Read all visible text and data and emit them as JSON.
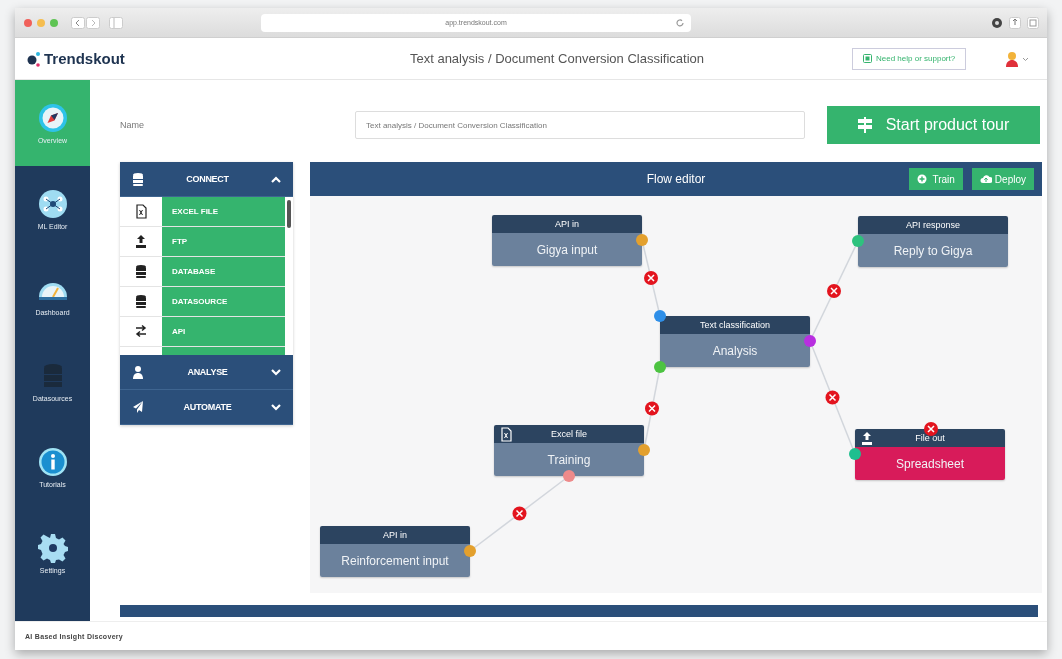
{
  "browser": {
    "url": "app.trendskout.com"
  },
  "header": {
    "logo": "Trendskout",
    "title": "Text analysis / Document Conversion Classification",
    "help_button": "Need help or support?"
  },
  "nav": [
    {
      "label": "Overview",
      "kind": "compass",
      "selected": true
    },
    {
      "label": "ML Editor",
      "kind": "network",
      "selected": false
    },
    {
      "label": "Dashboard",
      "kind": "gauge",
      "selected": false
    },
    {
      "label": "Datasources",
      "kind": "database",
      "selected": false
    },
    {
      "label": "Tutorials",
      "kind": "info",
      "selected": false
    },
    {
      "label": "Settings",
      "kind": "gear",
      "selected": false
    }
  ],
  "name_field": {
    "label": "Name",
    "value": "Text analysis / Document Conversion Classification"
  },
  "tour_button": "Start product tour",
  "toolbox": [
    {
      "label": "CONNECT",
      "kind": "database",
      "expanded": true,
      "items": [
        {
          "label": "EXCEL FILE",
          "kind": "file"
        },
        {
          "label": "FTP",
          "kind": "upload"
        },
        {
          "label": "DATABASE",
          "kind": "database"
        },
        {
          "label": "DATASOURCE",
          "kind": "database"
        },
        {
          "label": "API",
          "kind": "exchange"
        }
      ]
    },
    {
      "label": "ANALYSE",
      "kind": "person",
      "expanded": false
    },
    {
      "label": "AUTOMATE",
      "kind": "send",
      "expanded": false
    }
  ],
  "flow_editor": {
    "title": "Flow editor",
    "buttons": [
      {
        "label": "Train",
        "kind": "plus"
      },
      {
        "label": "Deploy",
        "kind": "cloud"
      }
    ],
    "nodes": [
      {
        "type": "API in",
        "kind": "api",
        "name": "Gigya input",
        "color": "#6b819c",
        "ports": [
          {
            "color": "#e3a02e"
          }
        ]
      },
      {
        "type": "API response",
        "kind": "api",
        "name": "Reply to Gigya",
        "color": "#6b819c",
        "ports": [
          {
            "color": "#2ec27e"
          }
        ]
      },
      {
        "type": "Text classification",
        "kind": "api",
        "name": "Analysis",
        "color": "#6b819c",
        "ports": [
          {
            "color": "#2f8fe8"
          },
          {
            "color": "#b82fe0"
          },
          {
            "color": "#4cc341"
          }
        ]
      },
      {
        "type": "Excel file",
        "kind": "file",
        "name": "Training",
        "color": "#6b819c",
        "ports": [
          {
            "color": "#e3a02e"
          },
          {
            "color": "#ee8a8a"
          }
        ]
      },
      {
        "type": "File out",
        "kind": "upload",
        "name": "Spreadsheet",
        "color": "#d81b5a",
        "ports": [
          {
            "color": "#1fbf8f"
          }
        ]
      },
      {
        "type": "API in",
        "kind": "api",
        "name": "Reinforcement input",
        "color": "#6b819c",
        "ports": [
          {
            "color": "#e3a02e"
          }
        ]
      }
    ]
  },
  "footer": {
    "tagline": "AI Based Insight Discovery"
  }
}
